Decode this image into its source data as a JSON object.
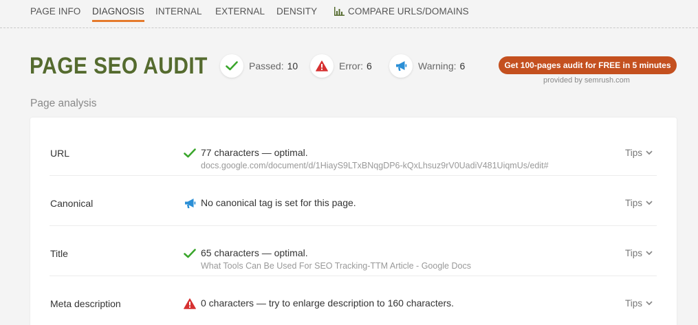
{
  "nav": {
    "items": [
      "PAGE INFO",
      "DIAGNOSIS",
      "INTERNAL",
      "EXTERNAL",
      "DENSITY",
      "COMPARE URLS/DOMAINS"
    ],
    "active": "DIAGNOSIS"
  },
  "header": {
    "title": "PAGE SEO AUDIT",
    "passed_label": "Passed:",
    "passed_count": "10",
    "error_label": "Error:",
    "error_count": "6",
    "warning_label": "Warning:",
    "warning_count": "6",
    "cta_label": "Get 100-pages audit for FREE in 5 minutes",
    "provided_by": "provided by  semrush.com"
  },
  "section_label": "Page analysis",
  "rows": [
    {
      "name": "URL",
      "status": "passed",
      "icon": "check-icon",
      "text": "77 characters — optimal.",
      "sub": "docs.google.com/document/d/1HiayS9LTxBNqgDP6-kQxLhsuz9rV0UadiV481UiqmUs/edit#",
      "tips": "Tips"
    },
    {
      "name": "Canonical",
      "status": "warning",
      "icon": "megaphone-icon",
      "text": "No canonical tag is set for this page.",
      "sub": "",
      "tips": "Tips"
    },
    {
      "name": "Title",
      "status": "passed",
      "icon": "check-icon",
      "text": "65 characters — optimal.",
      "sub": "What Tools Can Be Used For SEO Tracking-TTM Article - Google Docs",
      "tips": "Tips"
    },
    {
      "name": "Meta description",
      "status": "error",
      "icon": "warning-triangle-icon",
      "text": "0 characters — try to enlarge description to 160 characters.",
      "sub": "",
      "tips": "Tips"
    }
  ],
  "colors": {
    "title": "#556b2f",
    "accent": "#e57a2c",
    "cta": "#c4501f",
    "passed": "#3aa62c",
    "error": "#d63131",
    "warning": "#2b8fd6"
  }
}
